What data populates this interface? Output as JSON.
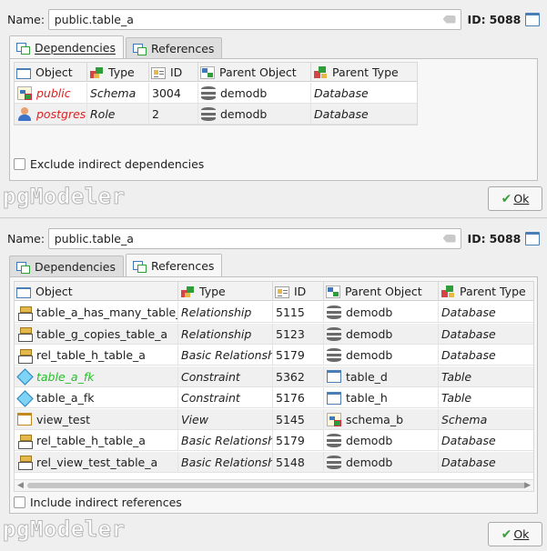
{
  "top_panel": {
    "name_label": "Name:",
    "name_value": "public.table_a",
    "id_label": "ID:",
    "id_value": "5088",
    "tabs": [
      {
        "label": "Dependencies",
        "active": true
      },
      {
        "label": "References",
        "active": false
      }
    ],
    "columns": [
      "Object",
      "Type",
      "ID",
      "Parent Object",
      "Parent Type"
    ],
    "rows": [
      {
        "object": "public",
        "type": "Schema",
        "id": "3004",
        "parent_object": "demodb",
        "parent_type": "Database",
        "object_icon": "schema-icon",
        "parent_icon": "database-icon",
        "object_color": "#e02020"
      },
      {
        "object": "postgres",
        "type": "Role",
        "id": "2",
        "parent_object": "demodb",
        "parent_type": "Database",
        "object_icon": "role-icon",
        "parent_icon": "database-icon",
        "object_color": "#e02020"
      }
    ],
    "checkbox_label": "Exclude indirect dependencies",
    "checkbox_checked": false,
    "logo": "pgModeler",
    "ok_label": "Ok"
  },
  "bottom_panel": {
    "name_label": "Name:",
    "name_value": "public.table_a",
    "id_label": "ID:",
    "id_value": "5088",
    "tabs": [
      {
        "label": "Dependencies",
        "active": false
      },
      {
        "label": "References",
        "active": true
      }
    ],
    "columns": [
      "Object",
      "Type",
      "ID",
      "Parent Object",
      "Parent Type"
    ],
    "rows": [
      {
        "object": "table_a_has_many_table_d",
        "type": "Relationship",
        "id": "5115",
        "parent_object": "demodb",
        "parent_type": "Database",
        "object_icon": "relationship-icon",
        "parent_icon": "database-icon"
      },
      {
        "object": "table_g_copies_table_a",
        "type": "Relationship",
        "id": "5123",
        "parent_object": "demodb",
        "parent_type": "Database",
        "object_icon": "relationship-icon",
        "parent_icon": "database-icon"
      },
      {
        "object": "rel_table_h_table_a",
        "type": "Basic Relationship",
        "id": "5179",
        "parent_object": "demodb",
        "parent_type": "Database",
        "object_icon": "basic-relationship-icon",
        "parent_icon": "database-icon"
      },
      {
        "object": "table_a_fk",
        "type": "Constraint",
        "id": "5362",
        "parent_object": "table_d",
        "parent_type": "Table",
        "object_icon": "constraint-icon",
        "parent_icon": "table-icon",
        "object_color": "#25c02a"
      },
      {
        "object": "table_a_fk",
        "type": "Constraint",
        "id": "5176",
        "parent_object": "table_h",
        "parent_type": "Table",
        "object_icon": "constraint-icon",
        "parent_icon": "table-icon"
      },
      {
        "object": "view_test",
        "type": "View",
        "id": "5145",
        "parent_object": "schema_b",
        "parent_type": "Schema",
        "object_icon": "view-icon",
        "parent_icon": "schema-icon"
      },
      {
        "object": "rel_table_h_table_a",
        "type": "Basic Relationship",
        "id": "5179",
        "parent_object": "demodb",
        "parent_type": "Database",
        "object_icon": "basic-relationship-icon",
        "parent_icon": "database-icon"
      },
      {
        "object": "rel_view_test_table_a",
        "type": "Basic Relationship",
        "id": "5148",
        "parent_object": "demodb",
        "parent_type": "Database",
        "object_icon": "basic-relationship-icon",
        "parent_icon": "database-icon"
      }
    ],
    "checkbox_label": "Include indirect references",
    "checkbox_checked": false,
    "logo": "pgModeler",
    "ok_label": "Ok"
  }
}
